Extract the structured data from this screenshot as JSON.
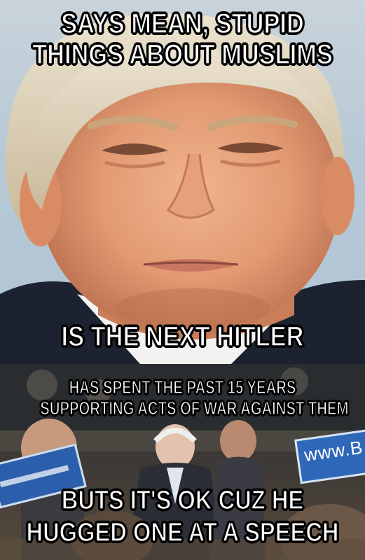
{
  "meme": {
    "top_caption": {
      "line1": "SAYS MEAN, STUPID",
      "line2": "THINGS ABOUT MUSLIMS"
    },
    "middle_caption": "IS THE NEXT HITLER",
    "sub_caption": {
      "line1": "HAS SPENT THE PAST 15 YEARS",
      "line2": "SUPPORTING ACTS OF WAR AGAINST THEM"
    },
    "bottom_caption": {
      "line1": "BUTS IT'S OK CUZ HE",
      "line2": "HUGGED ONE AT A SPEECH"
    },
    "sign_text": "www.B"
  },
  "colors": {
    "caption_fill": "#ffffff",
    "caption_stroke": "#000000",
    "sign_blue": "#2f68b8"
  },
  "icons": [
    "portrait-photo",
    "rally-photo"
  ]
}
